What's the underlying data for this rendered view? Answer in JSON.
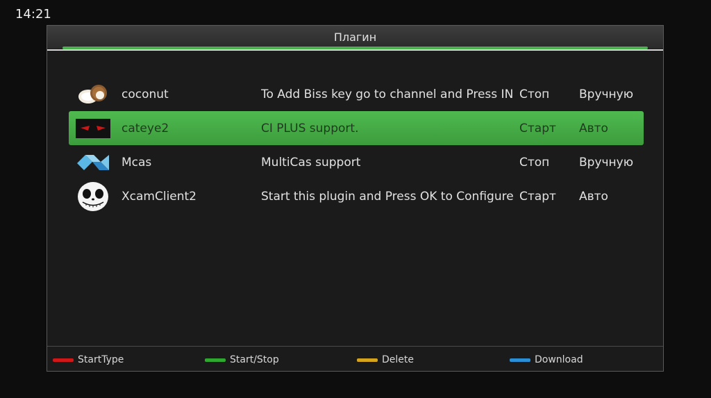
{
  "clock": "14:21",
  "window": {
    "title": "Плагин",
    "progress_fraction": 1.0,
    "accent_color": "#4caf50"
  },
  "plugins": [
    {
      "icon": "coconut-icon",
      "name": "coconut",
      "description": "To Add Biss key go to channel and Press INFO",
      "state": "Стоп",
      "mode": "Вручную",
      "selected": false
    },
    {
      "icon": "cateye-icon",
      "name": "cateye2",
      "description": "CI PLUS support.",
      "state": "Старт",
      "mode": "Авто",
      "selected": true
    },
    {
      "icon": "mcas-icon",
      "name": "Mcas",
      "description": "MultiCas support",
      "state": "Стоп",
      "mode": "Вручную",
      "selected": false
    },
    {
      "icon": "skull-icon",
      "name": "XcamClient2",
      "description": "Start this plugin and Press OK to Configure",
      "state": "Старт",
      "mode": "Авто",
      "selected": false
    }
  ],
  "footer": {
    "red": {
      "label": "StartType",
      "color": "#d01818"
    },
    "green": {
      "label": "Start/Stop",
      "color": "#2fa82f"
    },
    "yellow": {
      "label": "Delete",
      "color": "#d4a51c"
    },
    "blue": {
      "label": "Download",
      "color": "#2b8fd6"
    }
  }
}
